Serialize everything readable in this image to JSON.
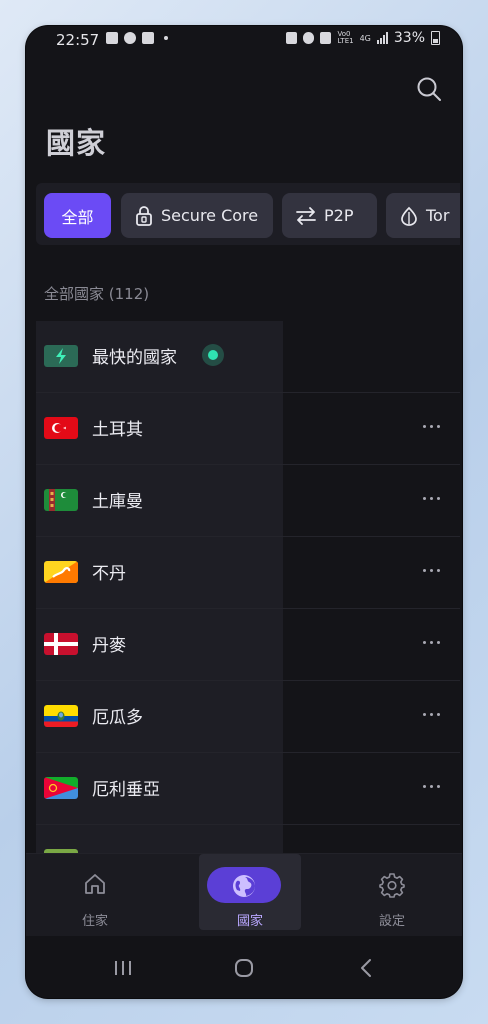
{
  "status_bar": {
    "time": "22:57",
    "battery": "33%",
    "network_top": "Vo0",
    "network_bottom": "LTE1",
    "net_type": "4G"
  },
  "header": {
    "title": "國家"
  },
  "filters": [
    {
      "label": "全部",
      "icon": "none",
      "active": true
    },
    {
      "label": "Secure Core",
      "icon": "lock-icon",
      "active": false
    },
    {
      "label": "P2P",
      "icon": "swap-arrows-icon",
      "active": false
    },
    {
      "label": "Tor",
      "icon": "onion-icon",
      "active": false
    }
  ],
  "section": {
    "label": "全部國家 (112)"
  },
  "countries": [
    {
      "name": "最快的國家",
      "flag": "lightning-icon",
      "fastest": true
    },
    {
      "name": "土耳其",
      "flag": "turkey-flag"
    },
    {
      "name": "土庫曼",
      "flag": "turkmenistan-flag"
    },
    {
      "name": "不丹",
      "flag": "bhutan-flag"
    },
    {
      "name": "丹麥",
      "flag": "denmark-flag"
    },
    {
      "name": "厄瓜多",
      "flag": "ecuador-flag"
    },
    {
      "name": "厄利垂亞",
      "flag": "eritrea-flag"
    }
  ],
  "bottom_nav": [
    {
      "label": "住家",
      "icon": "home-icon",
      "active": false
    },
    {
      "label": "國家",
      "icon": "globe-icon",
      "active": true
    },
    {
      "label": "設定",
      "icon": "gear-icon",
      "active": false
    }
  ],
  "colors": {
    "accent": "#6b4bf5",
    "background": "#141418",
    "fastest_dot": "#2fe3b1"
  }
}
